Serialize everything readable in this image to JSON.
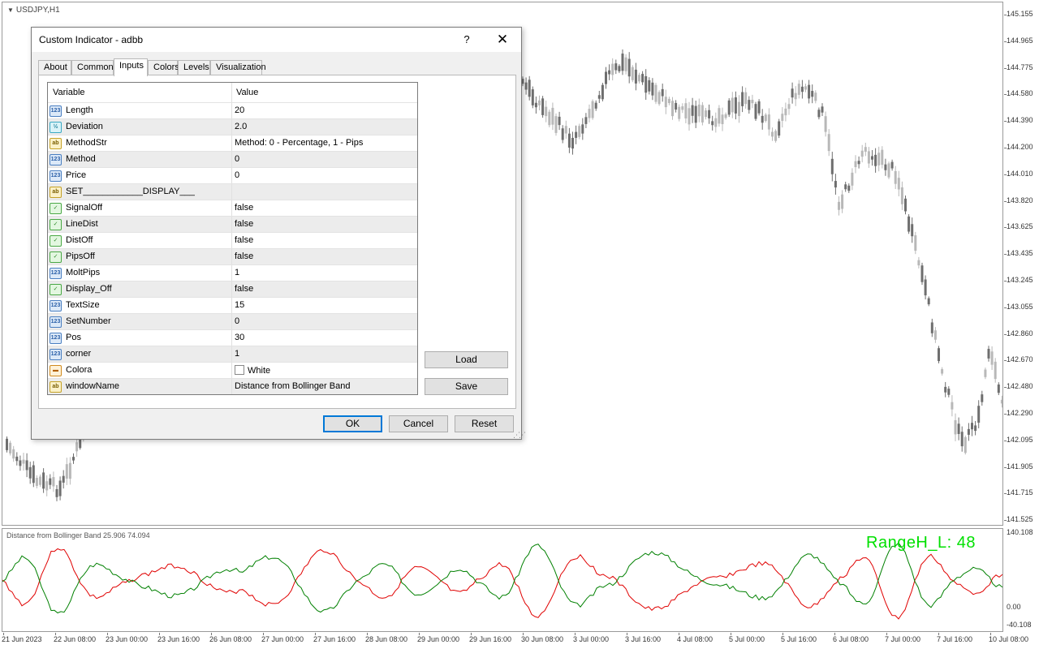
{
  "chart": {
    "symbol": "USDJPY,H1",
    "price_labels": [
      "145.155",
      "144.965",
      "144.775",
      "144.580",
      "144.390",
      "144.200",
      "144.010",
      "143.820",
      "143.625",
      "143.435",
      "143.245",
      "143.055",
      "142.860",
      "142.670",
      "142.480",
      "142.290",
      "142.095",
      "141.905",
      "141.715",
      "141.525"
    ],
    "indicator_title": "Distance from Bollinger Band 25.906 74.094",
    "range_label": "RangeH_L:   48",
    "indicator_axis": [
      "140.108",
      "0.00",
      "-40.108"
    ],
    "time_labels": [
      "21 Jun 2023",
      "22 Jun 08:00",
      "23 Jun 00:00",
      "23 Jun 16:00",
      "26 Jun 08:00",
      "27 Jun 00:00",
      "27 Jun 16:00",
      "28 Jun 08:00",
      "29 Jun 00:00",
      "29 Jun 16:00",
      "30 Jun 08:00",
      "3 Jul 00:00",
      "3 Jul 16:00",
      "4 Jul 08:00",
      "5 Jul 00:00",
      "5 Jul 16:00",
      "6 Jul 08:00",
      "7 Jul 00:00",
      "7 Jul 16:00",
      "10 Jul 08:00"
    ],
    "colors": {
      "bull": "#b8b8b8",
      "bear": "#6e6e6e",
      "line_red": "#e00000",
      "line_green": "#008000",
      "range": "#00e000"
    }
  },
  "dialog": {
    "title": "Custom Indicator - adbb",
    "help": "?",
    "close": "✕",
    "tabs": [
      "About",
      "Common",
      "Inputs",
      "Colors",
      "Levels",
      "Visualization"
    ],
    "active_tab": "Inputs",
    "columns": {
      "variable": "Variable",
      "value": "Value"
    },
    "params": [
      {
        "type": "int",
        "icon": "123",
        "name": "Length",
        "value": "20"
      },
      {
        "type": "dbl",
        "icon": "½",
        "name": "Deviation",
        "value": "2.0"
      },
      {
        "type": "str",
        "icon": "ab",
        "name": "MethodStr",
        "value": "Method: 0 - Percentage, 1 - Pips"
      },
      {
        "type": "int",
        "icon": "123",
        "name": "Method",
        "value": "0"
      },
      {
        "type": "int",
        "icon": "123",
        "name": "Price",
        "value": "0"
      },
      {
        "type": "str",
        "icon": "ab",
        "name": "SET____________DISPLAY___",
        "value": ""
      },
      {
        "type": "bool",
        "icon": "✓",
        "name": "SignalOff",
        "value": "false"
      },
      {
        "type": "bool",
        "icon": "✓",
        "name": "LineDist",
        "value": "false"
      },
      {
        "type": "bool",
        "icon": "✓",
        "name": "DistOff",
        "value": "false"
      },
      {
        "type": "bool",
        "icon": "✓",
        "name": "PipsOff",
        "value": "false"
      },
      {
        "type": "int",
        "icon": "123",
        "name": "MoltPips",
        "value": "1"
      },
      {
        "type": "bool",
        "icon": "✓",
        "name": "Display_Off",
        "value": "false"
      },
      {
        "type": "int",
        "icon": "123",
        "name": "TextSize",
        "value": "15"
      },
      {
        "type": "int",
        "icon": "123",
        "name": "SetNumber",
        "value": "0"
      },
      {
        "type": "int",
        "icon": "123",
        "name": "Pos",
        "value": "30"
      },
      {
        "type": "int",
        "icon": "123",
        "name": "corner",
        "value": "1"
      },
      {
        "type": "col",
        "icon": "▬",
        "name": "Colora",
        "value": "White",
        "swatch": "#ffffff"
      },
      {
        "type": "str",
        "icon": "ab",
        "name": "windowName",
        "value": "Distance from Bollinger Band"
      }
    ],
    "load": "Load",
    "save": "Save",
    "ok": "OK",
    "cancel": "Cancel",
    "reset": "Reset"
  }
}
